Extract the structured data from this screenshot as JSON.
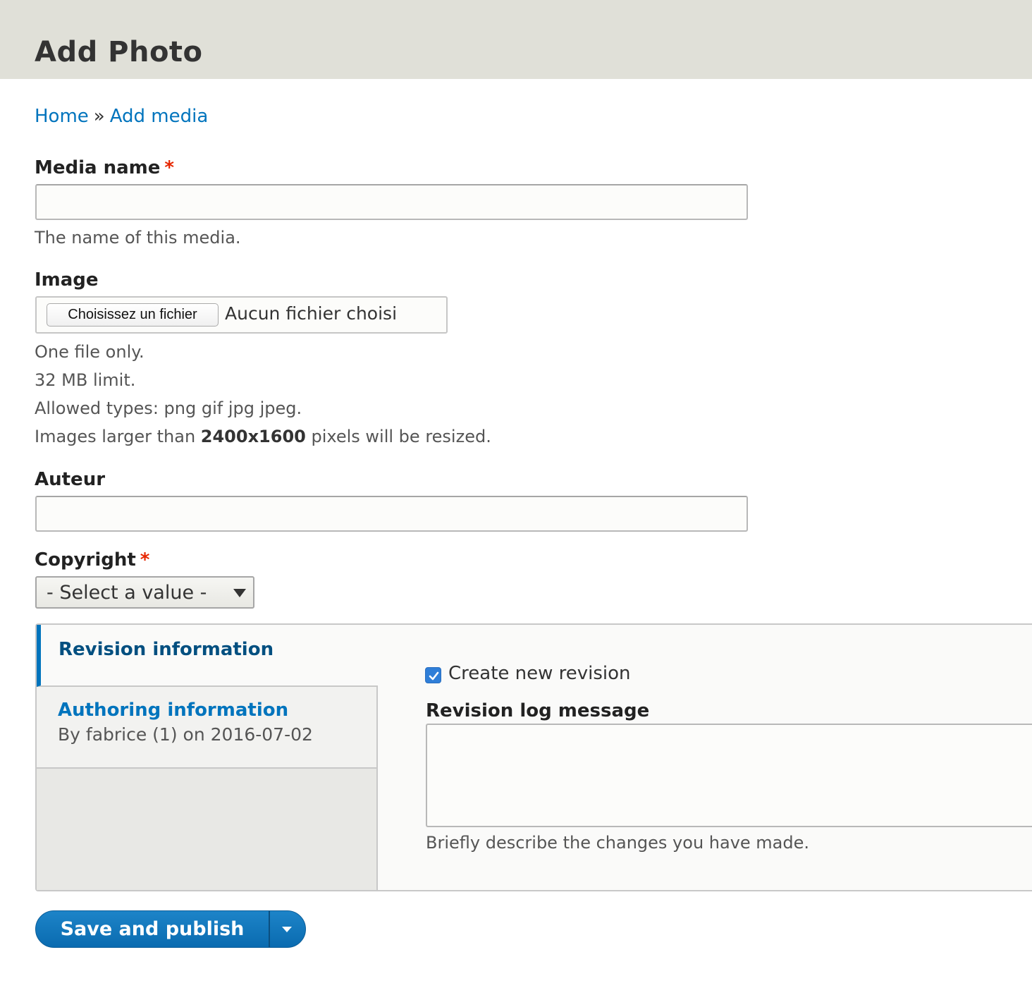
{
  "header": {
    "title": "Add Photo"
  },
  "breadcrumb": {
    "home": "Home",
    "separator": "»",
    "current": "Add media"
  },
  "media_name": {
    "label": "Media name",
    "required_mark": "*",
    "value": "",
    "description": "The name of this media."
  },
  "image": {
    "label": "Image",
    "button": "Choisissez un fichier",
    "status": "Aucun fichier choisi",
    "help": {
      "line1": "One file only.",
      "line2": "32 MB limit.",
      "line3": "Allowed types: png gif jpg jpeg.",
      "line4_prefix": "Images larger than ",
      "line4_bold": "2400x1600",
      "line4_suffix": " pixels will be resized."
    }
  },
  "auteur": {
    "label": "Auteur",
    "value": ""
  },
  "copyright": {
    "label": "Copyright",
    "required_mark": "*",
    "selected": "- Select a value -"
  },
  "vertical_tabs": {
    "revision": {
      "title": "Revision information"
    },
    "authoring": {
      "title": "Authoring information",
      "summary": "By fabrice (1) on 2016-07-02"
    },
    "pane": {
      "checkbox_label": "Create new revision",
      "checkbox_checked": true,
      "log_label": "Revision log message",
      "log_value": "",
      "log_description": "Briefly describe the changes you have made."
    }
  },
  "actions": {
    "save": "Save and publish"
  },
  "colors": {
    "link": "#0074bd",
    "required": "#e62600",
    "header_bg": "#e0e0d8",
    "button": "#0a6bb0"
  }
}
